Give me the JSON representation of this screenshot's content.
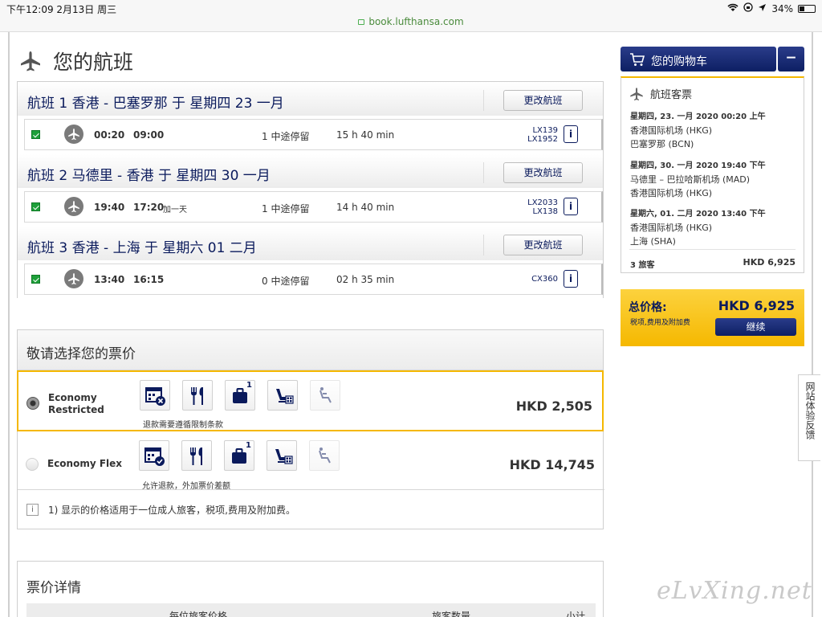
{
  "status": {
    "time_date": "下午12:09   2月13日 周三",
    "battery": "34%"
  },
  "browser": {
    "url": "book.lufthansa.com"
  },
  "page": {
    "title": "您的航班"
  },
  "change_label": "更改航班",
  "flights": [
    {
      "title": "航班 1 香港 - 巴塞罗那 于 星期四 23 一月",
      "dep": "00:20",
      "arr": "09:00",
      "plus_day": "",
      "stops": "1 中途停留",
      "duration": "15 h 40 min",
      "flight_nos": [
        "LX139",
        "LX1952"
      ]
    },
    {
      "title": "航班 2 马德里 - 香港 于 星期四 30 一月",
      "dep": "19:40",
      "arr": "17:20",
      "plus_day": "加一天",
      "stops": "1 中途停留",
      "duration": "14 h 40 min",
      "flight_nos": [
        "LX2033",
        "LX138"
      ]
    },
    {
      "title": "航班 3 香港 - 上海 于 星期六 01 二月",
      "dep": "13:40",
      "arr": "16:15",
      "plus_day": "",
      "stops": "0 中途停留",
      "duration": "02 h 35 min",
      "flight_nos": [
        "CX360"
      ]
    }
  ],
  "fares": {
    "heading": "敬请选择您的票价",
    "options": [
      {
        "name_line1": "Economy",
        "name_line2": "Restricted",
        "note": "退款需要遵循限制条款",
        "price": "HKD 2,505",
        "selected": true,
        "bag_count": "1"
      },
      {
        "name_line1": "Economy Flex",
        "name_line2": "",
        "note": "允许退款，外加票价差额",
        "price": "HKD 14,745",
        "selected": false,
        "bag_count": "1"
      }
    ],
    "footnote_icon": "i",
    "footnote": "1) 显示的价格适用于一位成人旅客，税项,费用及附加费。"
  },
  "details": {
    "heading": "票价详情",
    "columns": [
      "每位旅客价格",
      "旅客数量",
      "小计"
    ]
  },
  "cart": {
    "title": "您的购物车",
    "minimize": "−",
    "section": "航班客票",
    "segments": [
      {
        "date": "星期四, 23. 一月 2020 00:20 上午",
        "from": "香港国际机场 (HKG)",
        "to": "巴塞罗那 (BCN)"
      },
      {
        "date": "星期四, 30. 一月 2020 19:40 下午",
        "from": "马德里 – 巴拉哈斯机场 (MAD)",
        "to": "香港国际机场 (HKG)"
      },
      {
        "date": "星期六, 01. 二月 2020 13:40 下午",
        "from": "香港国际机场 (HKG)",
        "to": "上海 (SHA)"
      }
    ],
    "passengers": "3 旅客",
    "passengers_price": "HKD 6,925",
    "total_label": "总价格:",
    "total_price": "HKD 6,925",
    "total_note": "税项,费用及附加费",
    "continue": "继续"
  },
  "feedback": "网站体验反馈",
  "watermark": "eLvXing.net",
  "colors": {
    "navy": "#0a1a5c",
    "yellow": "#f5b800",
    "green": "#1ea03a"
  }
}
